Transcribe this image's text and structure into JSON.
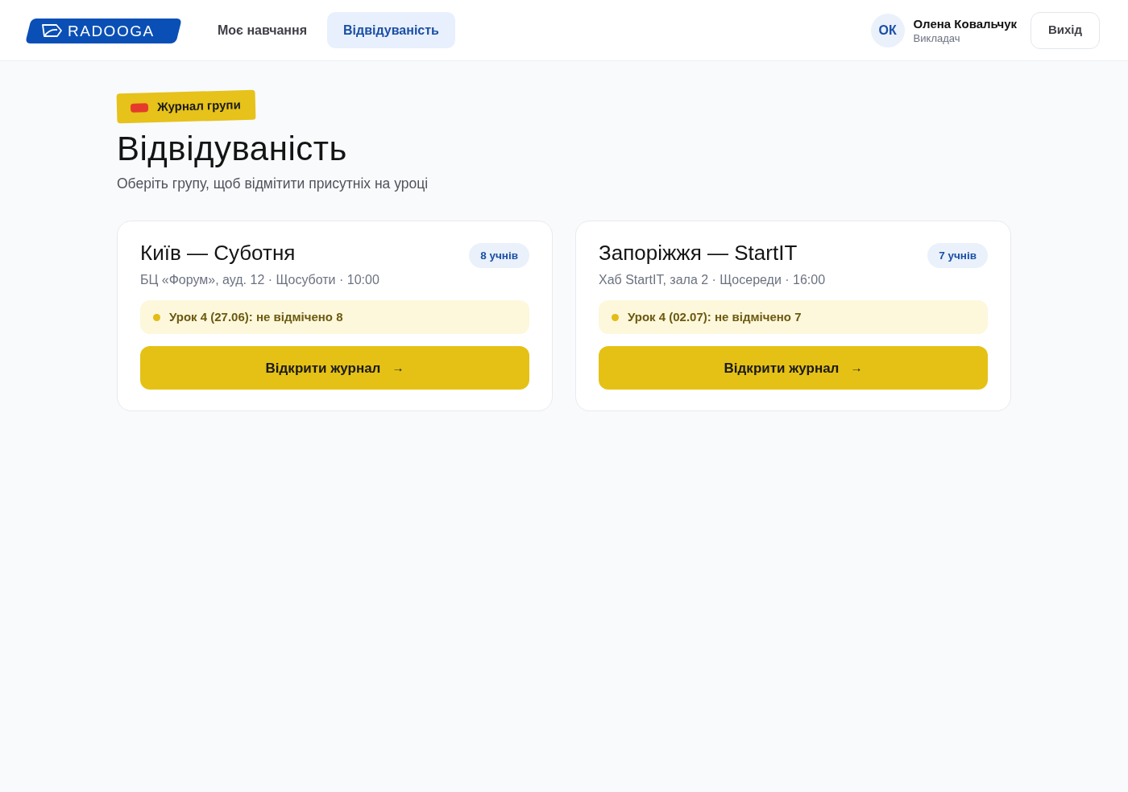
{
  "header": {
    "logo": {
      "text": "RADOOGA"
    },
    "nav": [
      {
        "label": "Моє навчання",
        "selected": false
      },
      {
        "label": "Відвідуваність",
        "selected": true
      }
    ],
    "user": {
      "initials": "ОК",
      "name": "Олена Ковальчук",
      "role": "Викладач"
    },
    "logout_button": "Вихід"
  },
  "page": {
    "tag": "Журнал групи",
    "title": "Відвідуваність",
    "subtitle": "Оберіть групу, щоб відмітити присутніх на уроці"
  },
  "groups": [
    {
      "title": "Київ — Суботня",
      "count": "8 учнів",
      "details": "БЦ «Форум», ауд. 12 · Щосуботи · 10:00",
      "notice": "Урок 4 (27.06): не відмічено 8",
      "button": {
        "label": "Відкрити журнал",
        "arrow": "→"
      }
    },
    {
      "title": "Запоріжжя — StartIT",
      "count": "7 учнів",
      "details": "Хаб StartIT, зала 2 · Щосереди · 16:00",
      "notice": "Урок 4 (02.07): не відмічено 7",
      "button": {
        "label": "Відкрити журнал",
        "arrow": "→"
      }
    }
  ]
}
